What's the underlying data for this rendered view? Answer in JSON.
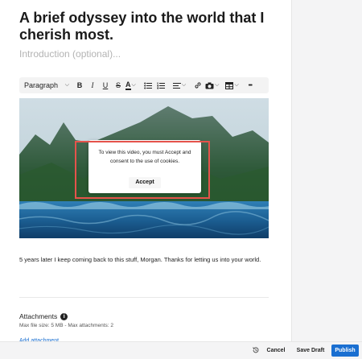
{
  "post": {
    "title": "A brief odyssey into the world that I cherish most.",
    "intro_placeholder": "Introduction (optional)...",
    "body_text": "5 years later I keep coming back to this stuff, Morgan. Thanks for letting us into your world."
  },
  "toolbar": {
    "paragraph_label": "Paragraph",
    "bold": "B",
    "italic": "I",
    "underline": "U",
    "strike": "S",
    "font_color": "A",
    "more": "•••"
  },
  "video": {
    "consent_text": "To view this video, you must Accept and consent to the use of cookies.",
    "accept_label": "Accept"
  },
  "attachments": {
    "label": "Attachments",
    "meta": "Max file size: 5 MB - Max attachments: 2",
    "add_link": "Add attachment"
  },
  "footer": {
    "cancel_label": "Cancel",
    "save_draft_label": "Save Draft",
    "publish_label": "Publish"
  },
  "colors": {
    "accent": "#1a6fd1",
    "highlight": "#e5534b"
  }
}
